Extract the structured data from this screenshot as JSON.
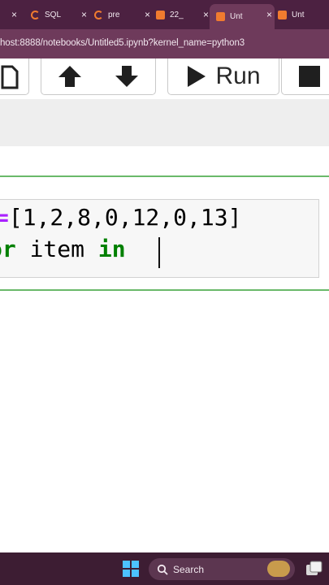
{
  "browser": {
    "tabs": [
      {
        "title": "",
        "icon": "none",
        "active": false
      },
      {
        "title": "SQL",
        "icon": "spinner-ring",
        "active": false
      },
      {
        "title": "pre",
        "icon": "spinner-ring",
        "active": false
      },
      {
        "title": "22_",
        "icon": "book",
        "active": false
      },
      {
        "title": "Unt",
        "icon": "book",
        "active": true
      },
      {
        "title": "Unt",
        "icon": "book",
        "active": false
      }
    ],
    "tab_close_glyph": "×",
    "address": "host:8888/notebooks/Untitled5.ipynb?kernel_name=python3"
  },
  "toolbar": {
    "run_label": "Run"
  },
  "cell": {
    "line1": {
      "op": "=",
      "value": "[1,2,8,0,12,0,13]"
    },
    "line2": {
      "kw1": "or",
      "var": " item ",
      "kw2": "in",
      "tail": " "
    }
  },
  "taskbar": {
    "search_label": "Search"
  },
  "colors": {
    "tabbar": "#4c2141",
    "addrbar": "#6e3a5b",
    "cell_border": "#6ab96a",
    "keyword": "#008000",
    "operator": "#aa22ff"
  }
}
